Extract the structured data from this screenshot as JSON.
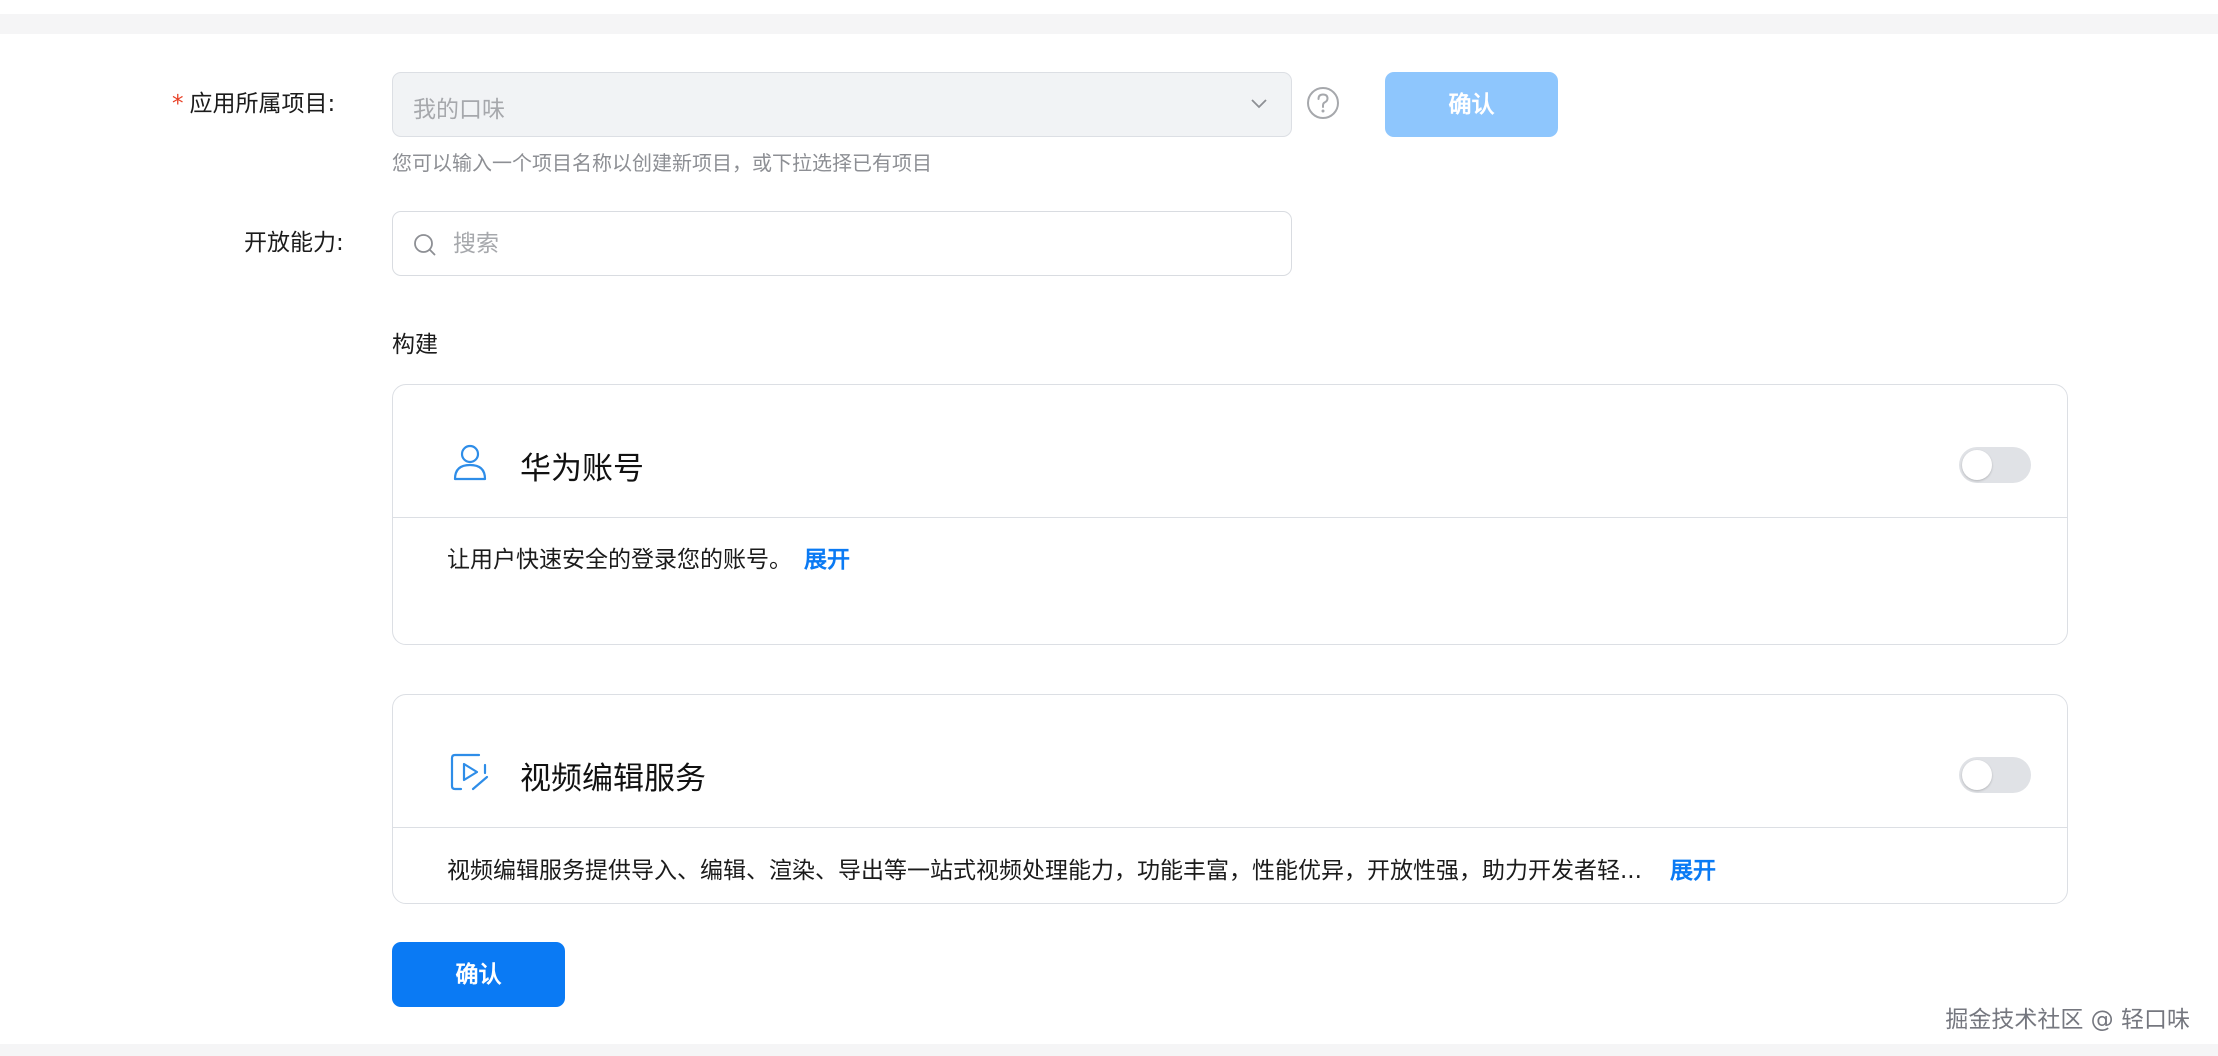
{
  "form": {
    "project_label": "应用所属项目:",
    "required_mark": "*",
    "project_value": "我的口味",
    "confirm_top_label": "确认",
    "hint": "您可以输入一个项目名称以创建新项目，或下拉选择已有项目",
    "capability_label": "开放能力:",
    "search_placeholder": "搜索"
  },
  "section": {
    "title": "构建"
  },
  "cards": [
    {
      "title": "华为账号",
      "icon": "user-icon",
      "enabled": false,
      "description": "让用户快速安全的登录您的账号。",
      "more": "展开"
    },
    {
      "title": "视频编辑服务",
      "icon": "video-edit-icon",
      "enabled": false,
      "description": "视频编辑服务提供导入、编辑、渲染、导出等一站式视频处理能力，功能丰富，性能优异，开放性强，助力开发者轻...",
      "more": "展开"
    }
  ],
  "footer": {
    "confirm_label": "确认",
    "watermark": "掘金技术社区 @ 轻口味"
  },
  "colors": {
    "primary": "#0a7af4",
    "primary_disabled": "#8ec6fd",
    "required": "#e84026",
    "icon_blue": "#2e8de8"
  }
}
